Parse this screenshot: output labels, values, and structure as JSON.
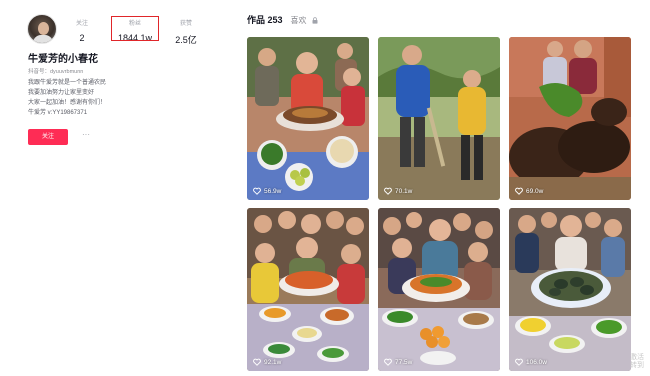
{
  "profile": {
    "nickname": "牛爱芳的小春花",
    "account": "抖音号：dyuuvrbmunn",
    "bio": [
      "我跟牛爱芳就是一个普通农民",
      "我要加油努力让家里变好",
      "大家一起加油！感谢有你们！",
      "牛爱芳 v:YY19867371"
    ],
    "follow_label": "关注",
    "more_label": "···"
  },
  "stats": {
    "following": {
      "label": "关注",
      "value": "2"
    },
    "fans": {
      "label": "粉丝",
      "value": "1844.1w"
    },
    "likes": {
      "label": "获赞",
      "value": "2.5亿"
    }
  },
  "tabs": {
    "works_label": "作品 253",
    "likes_label": "喜欢"
  },
  "videos": [
    {
      "likes": "56.9w"
    },
    {
      "likes": "70.1w"
    },
    {
      "likes": "69.0w"
    },
    {
      "likes": "92.1w"
    },
    {
      "likes": "77.5w"
    },
    {
      "likes": "106.0w"
    }
  ],
  "watermark": {
    "line1": "激活",
    "line2": "转到"
  },
  "colors": {
    "accent": "#fe2c55",
    "highlight_box": "#e0262a"
  }
}
